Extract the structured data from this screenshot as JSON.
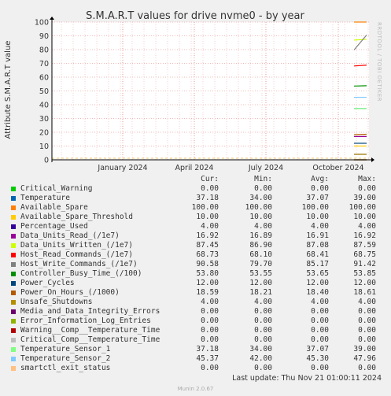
{
  "chart_data": {
    "type": "line",
    "title": "S.M.A.R.T values for drive nvme0 - by year",
    "ylabel": "Attribute S.M.A.R.T value",
    "ylim": [
      0,
      100
    ],
    "y_ticks": [
      "0",
      "10",
      "20",
      "30",
      "40",
      "50",
      "60",
      "70",
      "80",
      "90",
      "100"
    ],
    "x_ticks": [
      "January 2024",
      "April 2024",
      "July 2024",
      "October 2024"
    ],
    "grid": true,
    "series": [
      {
        "name": "Critical_Warning",
        "color": "#00cc00",
        "values": [
          0.0,
          0.0
        ]
      },
      {
        "name": "Temperature",
        "color": "#0066b3",
        "values": [
          37.18,
          37.18
        ]
      },
      {
        "name": "Available_Spare",
        "color": "#ff8000",
        "values": [
          100.0,
          100.0
        ]
      },
      {
        "name": "Available_Spare_Threshold",
        "color": "#ffcc00",
        "values": [
          10.0,
          10.0
        ]
      },
      {
        "name": "Percentage_Used",
        "color": "#330099",
        "values": [
          4.0,
          4.0
        ]
      },
      {
        "name": "Data_Units_Read_(/1e7)",
        "color": "#990099",
        "values": [
          16.89,
          16.92
        ]
      },
      {
        "name": "Data_Units_Written_(/1e7)",
        "color": "#ccff00",
        "values": [
          86.9,
          87.45
        ]
      },
      {
        "name": "Host_Read_Commands_(/1e7)",
        "color": "#ff0000",
        "values": [
          68.1,
          68.73
        ]
      },
      {
        "name": "Host_Write_Commands_(/1e7)",
        "color": "#808080",
        "values": [
          79.7,
          90.58
        ]
      },
      {
        "name": "Controller_Busy_Time_(/100)",
        "color": "#008f00",
        "values": [
          53.55,
          53.8
        ]
      },
      {
        "name": "Power_Cycles",
        "color": "#00487d",
        "values": [
          12.0,
          12.0
        ]
      },
      {
        "name": "Power_On_Hours_(/1000)",
        "color": "#b35a00",
        "values": [
          18.21,
          18.59
        ]
      },
      {
        "name": "Unsafe_Shutdowns",
        "color": "#b38f00",
        "values": [
          4.0,
          4.0
        ]
      },
      {
        "name": "Media_and_Data_Integrity_Errors",
        "color": "#6b006b",
        "values": [
          0.0,
          0.0
        ]
      },
      {
        "name": "Error_Information_Log_Entries",
        "color": "#8fb300",
        "values": [
          0.0,
          0.0
        ]
      },
      {
        "name": "Warning__Comp__Temperature_Time",
        "color": "#b30000",
        "values": [
          0.0,
          0.0
        ]
      },
      {
        "name": "Critical_Comp__Temperature_Time",
        "color": "#bebebe",
        "values": [
          0.0,
          0.0
        ]
      },
      {
        "name": "Temperature_Sensor_1",
        "color": "#80ff80",
        "values": [
          37.18,
          37.18
        ]
      },
      {
        "name": "Temperature_Sensor_2",
        "color": "#80c9ff",
        "values": [
          45.37,
          45.37
        ]
      },
      {
        "name": "smartctl_exit_status",
        "color": "#ffc080",
        "values": [
          0.0,
          0.0
        ]
      }
    ]
  },
  "legend": {
    "headers": [
      "Cur:",
      "Min:",
      "Avg:",
      "Max:"
    ],
    "rows": [
      {
        "name": "Critical_Warning",
        "color": "#00cc00",
        "cur": "0.00",
        "min": "0.00",
        "avg": "0.00",
        "max": "0.00"
      },
      {
        "name": "Temperature",
        "color": "#0066b3",
        "cur": "37.18",
        "min": "34.00",
        "avg": "37.07",
        "max": "39.00"
      },
      {
        "name": "Available_Spare",
        "color": "#ff8000",
        "cur": "100.00",
        "min": "100.00",
        "avg": "100.00",
        "max": "100.00"
      },
      {
        "name": "Available_Spare_Threshold",
        "color": "#ffcc00",
        "cur": "10.00",
        "min": "10.00",
        "avg": "10.00",
        "max": "10.00"
      },
      {
        "name": "Percentage_Used",
        "color": "#330099",
        "cur": "4.00",
        "min": "4.00",
        "avg": "4.00",
        "max": "4.00"
      },
      {
        "name": "Data_Units_Read_(/1e7)",
        "color": "#990099",
        "cur": "16.92",
        "min": "16.89",
        "avg": "16.91",
        "max": "16.92"
      },
      {
        "name": "Data_Units_Written_(/1e7)",
        "color": "#ccff00",
        "cur": "87.45",
        "min": "86.90",
        "avg": "87.08",
        "max": "87.59"
      },
      {
        "name": "Host_Read_Commands_(/1e7)",
        "color": "#ff0000",
        "cur": "68.73",
        "min": "68.10",
        "avg": "68.41",
        "max": "68.75"
      },
      {
        "name": "Host_Write_Commands_(/1e7)",
        "color": "#808080",
        "cur": "90.58",
        "min": "79.70",
        "avg": "85.17",
        "max": "91.42"
      },
      {
        "name": "Controller_Busy_Time_(/100)",
        "color": "#008f00",
        "cur": "53.80",
        "min": "53.55",
        "avg": "53.65",
        "max": "53.85"
      },
      {
        "name": "Power_Cycles",
        "color": "#00487d",
        "cur": "12.00",
        "min": "12.00",
        "avg": "12.00",
        "max": "12.00"
      },
      {
        "name": "Power_On_Hours_(/1000)",
        "color": "#b35a00",
        "cur": "18.59",
        "min": "18.21",
        "avg": "18.40",
        "max": "18.61"
      },
      {
        "name": "Unsafe_Shutdowns",
        "color": "#b38f00",
        "cur": "4.00",
        "min": "4.00",
        "avg": "4.00",
        "max": "4.00"
      },
      {
        "name": "Media_and_Data_Integrity_Errors",
        "color": "#6b006b",
        "cur": "0.00",
        "min": "0.00",
        "avg": "0.00",
        "max": "0.00"
      },
      {
        "name": "Error_Information_Log_Entries",
        "color": "#8fb300",
        "cur": "0.00",
        "min": "0.00",
        "avg": "0.00",
        "max": "0.00"
      },
      {
        "name": "Warning__Comp__Temperature_Time",
        "color": "#b30000",
        "cur": "0.00",
        "min": "0.00",
        "avg": "0.00",
        "max": "0.00"
      },
      {
        "name": "Critical_Comp__Temperature_Time",
        "color": "#bebebe",
        "cur": "0.00",
        "min": "0.00",
        "avg": "0.00",
        "max": "0.00"
      },
      {
        "name": "Temperature_Sensor_1",
        "color": "#80ff80",
        "cur": "37.18",
        "min": "34.00",
        "avg": "37.07",
        "max": "39.00"
      },
      {
        "name": "Temperature_Sensor_2",
        "color": "#80c9ff",
        "cur": "45.37",
        "min": "42.00",
        "avg": "45.30",
        "max": "47.96"
      },
      {
        "name": "smartctl_exit_status",
        "color": "#ffc080",
        "cur": "0.00",
        "min": "0.00",
        "avg": "0.00",
        "max": "0.00"
      }
    ]
  },
  "footer": {
    "last_update": "Last update: Thu Nov 21 01:00:11 2024",
    "munin": "Munin 2.0.67",
    "rrdtool": "RRDTOOL / TOBI OETIKER"
  }
}
